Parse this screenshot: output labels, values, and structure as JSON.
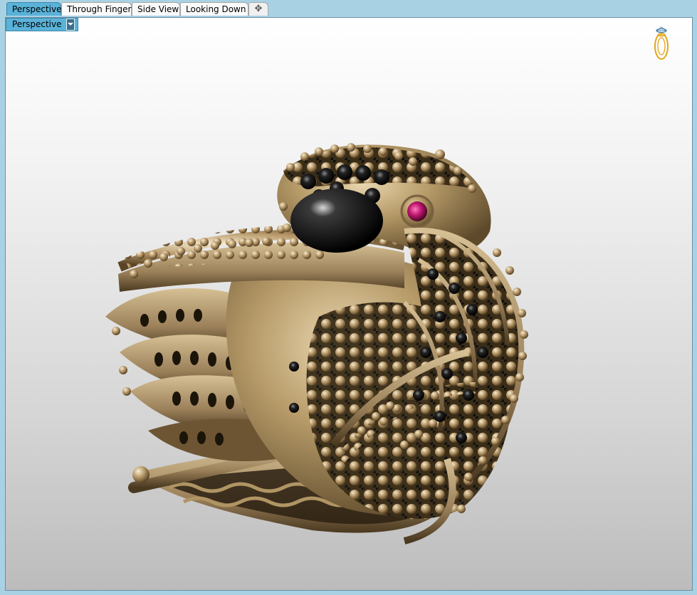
{
  "tabs": [
    {
      "label": "Perspective",
      "active": true
    },
    {
      "label": "Through Finger",
      "active": false
    },
    {
      "label": "Side View",
      "active": false
    },
    {
      "label": "Looking Down",
      "active": false
    }
  ],
  "add_tab_icon": "plus-icon",
  "viewport": {
    "name_label": "Perspective",
    "dropdown_icon": "chevron-down-icon",
    "orientation_widget_icon": "ring-orientation-icon"
  },
  "model": {
    "description_icon": "jewelry-ring-model",
    "metal_color": "#a88d60",
    "stone_color_dark": "#111111",
    "stone_color_eye": "#c0176e"
  },
  "colors": {
    "tab_bar": "#a9d1e4",
    "active_tab": "#5ab2d8",
    "viewport_top": "#ffffff",
    "viewport_bottom": "#bcbcbc"
  }
}
